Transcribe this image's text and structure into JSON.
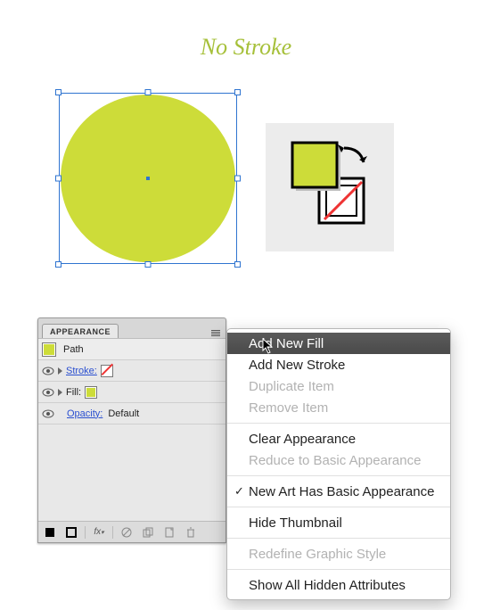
{
  "title": "No Stroke",
  "colors": {
    "shape_fill": "#cddc39",
    "selection": "#2f74d0"
  },
  "appearance": {
    "tab_label": "APPEARANCE",
    "object_label": "Path",
    "rows": {
      "stroke_label": "Stroke:",
      "fill_label": "Fill:",
      "opacity_label": "Opacity:",
      "opacity_value": "Default"
    }
  },
  "flyout": {
    "items": [
      {
        "label": "Add New Fill",
        "enabled": true,
        "highlight": true,
        "checked": false
      },
      {
        "label": "Add New Stroke",
        "enabled": true,
        "highlight": false,
        "checked": false
      },
      {
        "label": "Duplicate Item",
        "enabled": false,
        "highlight": false,
        "checked": false
      },
      {
        "label": "Remove Item",
        "enabled": false,
        "highlight": false,
        "checked": false
      },
      {
        "sep": true
      },
      {
        "label": "Clear Appearance",
        "enabled": true,
        "highlight": false,
        "checked": false
      },
      {
        "label": "Reduce to Basic Appearance",
        "enabled": false,
        "highlight": false,
        "checked": false
      },
      {
        "sep": true
      },
      {
        "label": "New Art Has Basic Appearance",
        "enabled": true,
        "highlight": false,
        "checked": true
      },
      {
        "sep": true
      },
      {
        "label": "Hide Thumbnail",
        "enabled": true,
        "highlight": false,
        "checked": false
      },
      {
        "sep": true
      },
      {
        "label": "Redefine Graphic Style",
        "enabled": false,
        "highlight": false,
        "checked": false
      },
      {
        "sep": true
      },
      {
        "label": "Show All Hidden Attributes",
        "enabled": true,
        "highlight": false,
        "checked": false
      }
    ]
  }
}
